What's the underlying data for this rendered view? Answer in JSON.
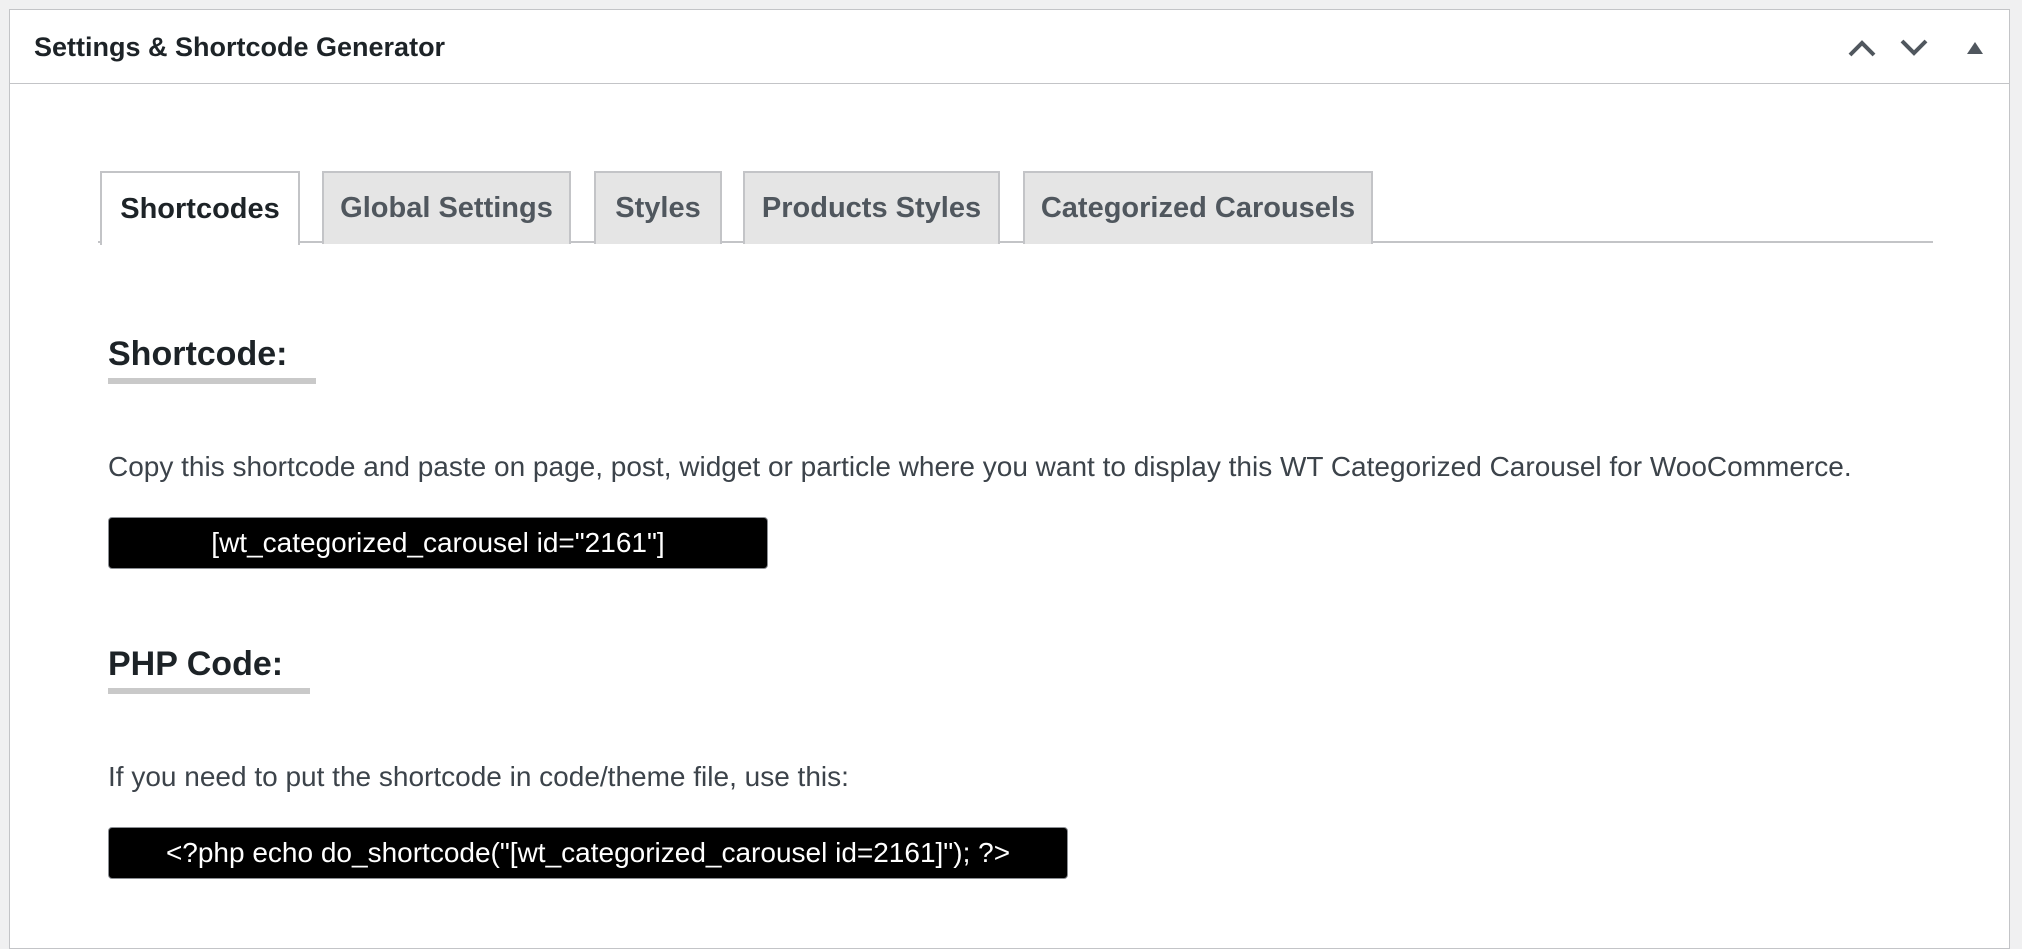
{
  "panel": {
    "title": "Settings & Shortcode Generator",
    "controls": [
      {
        "icon": "chevron-up-icon",
        "label": "Move up"
      },
      {
        "icon": "chevron-down-icon",
        "label": "Move down"
      },
      {
        "icon": "triangle-up-icon",
        "label": "Toggle panel"
      }
    ]
  },
  "tabs": [
    {
      "label": "Shortcodes",
      "active": true
    },
    {
      "label": "Global Settings",
      "active": false
    },
    {
      "label": "Styles",
      "active": false
    },
    {
      "label": "Products Styles",
      "active": false
    },
    {
      "label": "Categorized Carousels",
      "active": false
    }
  ],
  "shortcode_section": {
    "heading": "Shortcode:",
    "description": "Copy this shortcode and paste on page, post, widget or particle where you want to display this WT Categorized Carousel for WooCommerce.",
    "value": "[wt_categorized_carousel id=\"2161\"]"
  },
  "php_section": {
    "heading": "PHP Code:",
    "description": "If you need to put the shortcode in code/theme file, use this:",
    "value": "<?php echo do_shortcode(\"[wt_categorized_carousel id=2161]\"); ?>"
  },
  "colors": {
    "code_background": "#000000",
    "code_text": "#ffffff",
    "tab_inactive_background": "#e5e5e5",
    "heading_underline": "#c9c9c9"
  }
}
